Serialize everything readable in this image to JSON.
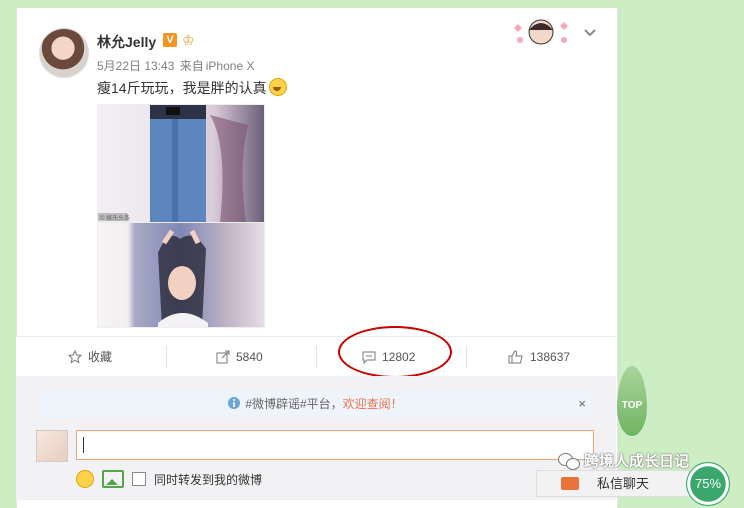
{
  "post": {
    "author": "林允Jelly",
    "badge": "V",
    "crown": "♔",
    "date": "5月22日 13:43",
    "source_prefix": "来自",
    "source": "iPhone X",
    "text": "瘦14斤玩玩，我是胖的认真",
    "photo_watermark": "© 娱乐头条"
  },
  "actions": {
    "favorite_label": "收藏",
    "repost_count": "5840",
    "comment_count": "12802",
    "like_count": "138637"
  },
  "comments": {
    "notice_prefix": "#微博辟谣#平台，",
    "notice_link": "欢迎查阅！",
    "notice_close": "×",
    "repost_checkbox_label": "同时转发到我的微博"
  },
  "overlay": {
    "top_label": "TOP",
    "watermark": "跨境人成长日记",
    "dm_label": "私信聊天",
    "percent": "75%"
  }
}
